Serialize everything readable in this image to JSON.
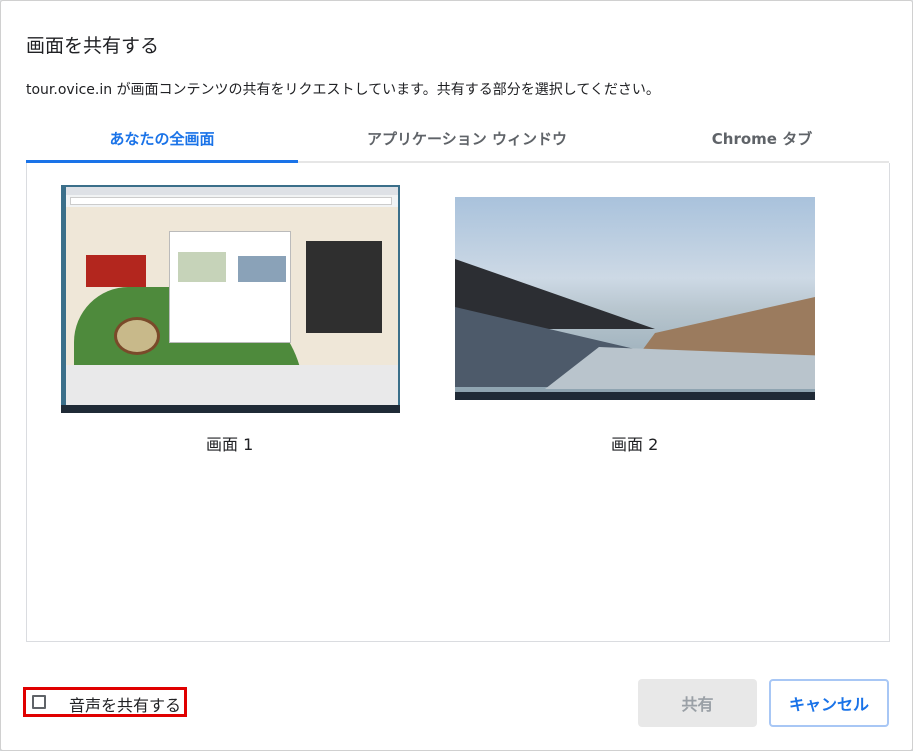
{
  "dialog": {
    "title": "画面を共有する",
    "subtitle": "tour.ovice.in が画面コンテンツの共有をリクエストしています。共有する部分を選択してください。"
  },
  "tabs": [
    {
      "label": "あなたの全画面",
      "active": true
    },
    {
      "label": "アプリケーション ウィンドウ",
      "active": false
    },
    {
      "label": "Chrome タブ",
      "active": false
    }
  ],
  "sources": [
    {
      "label": "画面 1"
    },
    {
      "label": "画面 2"
    }
  ],
  "audio": {
    "label": "音声を共有する",
    "checked": false
  },
  "buttons": {
    "share": "共有",
    "cancel": "キャンセル"
  },
  "colors": {
    "accent": "#1a73e8",
    "highlight": "#e00000"
  }
}
